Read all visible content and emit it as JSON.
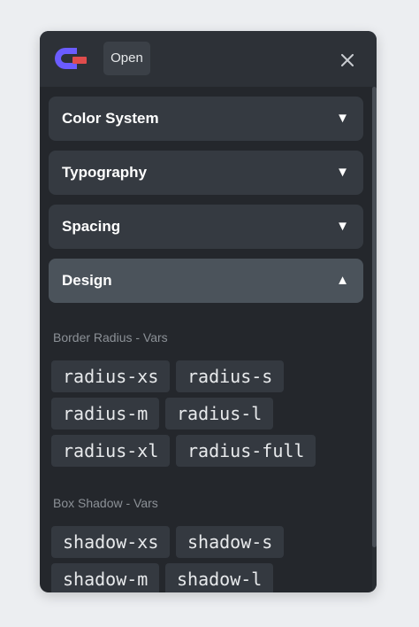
{
  "header": {
    "open_label": "Open",
    "logo_icon": "logo-icon",
    "close_icon": "close-icon",
    "colors": {
      "logo_blue": "#6b5cff",
      "logo_red": "#e04c4c"
    }
  },
  "accordion": [
    {
      "label": "Color System",
      "state": "collapsed",
      "caret": "▼"
    },
    {
      "label": "Typography",
      "state": "collapsed",
      "caret": "▼"
    },
    {
      "label": "Spacing",
      "state": "collapsed",
      "caret": "▼"
    },
    {
      "label": "Design",
      "state": "expanded",
      "caret": "▲"
    }
  ],
  "design": {
    "border_radius": {
      "label": "Border Radius - Vars",
      "chips": [
        "radius-xs",
        "radius-s",
        "radius-m",
        "radius-l",
        "radius-xl",
        "radius-full"
      ]
    },
    "box_shadow": {
      "label": "Box Shadow - Vars",
      "chips": [
        "shadow-xs",
        "shadow-s",
        "shadow-m",
        "shadow-l"
      ]
    }
  }
}
